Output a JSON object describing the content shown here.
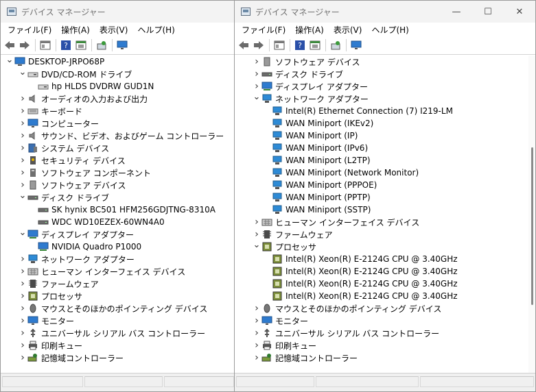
{
  "colors": {
    "accent": "#0067c0",
    "icon_blue": "#2e7bcf",
    "icon_gray": "#707070",
    "icon_green": "#2f7a2f"
  },
  "left": {
    "title": "デバイス マネージャー",
    "menu": [
      "ファイル(F)",
      "操作(A)",
      "表示(V)",
      "ヘルプ(H)"
    ],
    "tree": [
      {
        "depth": 0,
        "exp": "open",
        "icon": "computer-icon",
        "label": "DESKTOP-JRPO68P"
      },
      {
        "depth": 1,
        "exp": "open",
        "icon": "dvd-drive-icon",
        "label": "DVD/CD-ROM ドライブ"
      },
      {
        "depth": 2,
        "exp": "none",
        "icon": "dvd-drive-icon",
        "label": "hp HLDS DVDRW  GUD1N"
      },
      {
        "depth": 1,
        "exp": "closed",
        "icon": "speaker-icon",
        "label": "オーディオの入力および出力"
      },
      {
        "depth": 1,
        "exp": "closed",
        "icon": "keyboard-icon",
        "label": "キーボード"
      },
      {
        "depth": 1,
        "exp": "closed",
        "icon": "monitor-icon",
        "label": "コンピューター"
      },
      {
        "depth": 1,
        "exp": "closed",
        "icon": "speaker-icon",
        "label": "サウンド、ビデオ、およびゲーム コントローラー"
      },
      {
        "depth": 1,
        "exp": "closed",
        "icon": "system-device-icon",
        "label": "システム デバイス"
      },
      {
        "depth": 1,
        "exp": "closed",
        "icon": "security-device-icon",
        "label": "セキュリティ デバイス"
      },
      {
        "depth": 1,
        "exp": "closed",
        "icon": "software-component-icon",
        "label": "ソフトウェア コンポーネント"
      },
      {
        "depth": 1,
        "exp": "closed",
        "icon": "software-device-icon",
        "label": "ソフトウェア デバイス"
      },
      {
        "depth": 1,
        "exp": "open",
        "icon": "disk-drive-icon",
        "label": "ディスク ドライブ"
      },
      {
        "depth": 2,
        "exp": "none",
        "icon": "disk-drive-icon",
        "label": "SK hynix BC501 HFM256GDJTNG-8310A"
      },
      {
        "depth": 2,
        "exp": "none",
        "icon": "disk-drive-icon",
        "label": "WDC WD10EZEX-60WN4A0"
      },
      {
        "depth": 1,
        "exp": "open",
        "icon": "display-adapter-icon",
        "label": "ディスプレイ アダプター"
      },
      {
        "depth": 2,
        "exp": "none",
        "icon": "display-adapter-icon",
        "label": "NVIDIA Quadro P1000"
      },
      {
        "depth": 1,
        "exp": "closed",
        "icon": "network-adapter-icon",
        "label": "ネットワーク アダプター"
      },
      {
        "depth": 1,
        "exp": "closed",
        "icon": "hid-icon",
        "label": "ヒューマン インターフェイス デバイス"
      },
      {
        "depth": 1,
        "exp": "closed",
        "icon": "firmware-icon",
        "label": "ファームウェア"
      },
      {
        "depth": 1,
        "exp": "closed",
        "icon": "processor-icon",
        "label": "プロセッサ"
      },
      {
        "depth": 1,
        "exp": "closed",
        "icon": "mouse-icon",
        "label": "マウスとそのほかのポインティング デバイス"
      },
      {
        "depth": 1,
        "exp": "closed",
        "icon": "monitor-icon",
        "label": "モニター"
      },
      {
        "depth": 1,
        "exp": "closed",
        "icon": "usb-icon",
        "label": "ユニバーサル シリアル バス コントローラー"
      },
      {
        "depth": 1,
        "exp": "closed",
        "icon": "printer-icon",
        "label": "印刷キュー"
      },
      {
        "depth": 1,
        "exp": "closed",
        "icon": "storage-controller-icon",
        "label": "記憶域コントローラー"
      }
    ]
  },
  "right": {
    "title": "デバイス マネージャー",
    "menu": [
      "ファイル(F)",
      "操作(A)",
      "表示(V)",
      "ヘルプ(H)"
    ],
    "caption": {
      "minimize": "—",
      "maximize": "☐",
      "close": "✕"
    },
    "tree": [
      {
        "depth": 1,
        "exp": "closed",
        "icon": "software-device-icon",
        "label": "ソフトウェア デバイス"
      },
      {
        "depth": 1,
        "exp": "closed",
        "icon": "disk-drive-icon",
        "label": "ディスク ドライブ"
      },
      {
        "depth": 1,
        "exp": "closed",
        "icon": "display-adapter-icon",
        "label": "ディスプレイ アダプター"
      },
      {
        "depth": 1,
        "exp": "open",
        "icon": "network-adapter-icon",
        "label": "ネットワーク アダプター"
      },
      {
        "depth": 2,
        "exp": "none",
        "icon": "network-adapter-icon",
        "label": "Intel(R) Ethernet Connection (7) I219-LM"
      },
      {
        "depth": 2,
        "exp": "none",
        "icon": "network-adapter-icon",
        "label": "WAN Miniport (IKEv2)"
      },
      {
        "depth": 2,
        "exp": "none",
        "icon": "network-adapter-icon",
        "label": "WAN Miniport (IP)"
      },
      {
        "depth": 2,
        "exp": "none",
        "icon": "network-adapter-icon",
        "label": "WAN Miniport (IPv6)"
      },
      {
        "depth": 2,
        "exp": "none",
        "icon": "network-adapter-icon",
        "label": "WAN Miniport (L2TP)"
      },
      {
        "depth": 2,
        "exp": "none",
        "icon": "network-adapter-icon",
        "label": "WAN Miniport (Network Monitor)"
      },
      {
        "depth": 2,
        "exp": "none",
        "icon": "network-adapter-icon",
        "label": "WAN Miniport (PPPOE)"
      },
      {
        "depth": 2,
        "exp": "none",
        "icon": "network-adapter-icon",
        "label": "WAN Miniport (PPTP)"
      },
      {
        "depth": 2,
        "exp": "none",
        "icon": "network-adapter-icon",
        "label": "WAN Miniport (SSTP)"
      },
      {
        "depth": 1,
        "exp": "closed",
        "icon": "hid-icon",
        "label": "ヒューマン インターフェイス デバイス"
      },
      {
        "depth": 1,
        "exp": "closed",
        "icon": "firmware-icon",
        "label": "ファームウェア"
      },
      {
        "depth": 1,
        "exp": "open",
        "icon": "processor-icon",
        "label": "プロセッサ"
      },
      {
        "depth": 2,
        "exp": "none",
        "icon": "processor-icon",
        "label": "Intel(R) Xeon(R) E-2124G CPU @ 3.40GHz"
      },
      {
        "depth": 2,
        "exp": "none",
        "icon": "processor-icon",
        "label": "Intel(R) Xeon(R) E-2124G CPU @ 3.40GHz"
      },
      {
        "depth": 2,
        "exp": "none",
        "icon": "processor-icon",
        "label": "Intel(R) Xeon(R) E-2124G CPU @ 3.40GHz"
      },
      {
        "depth": 2,
        "exp": "none",
        "icon": "processor-icon",
        "label": "Intel(R) Xeon(R) E-2124G CPU @ 3.40GHz"
      },
      {
        "depth": 1,
        "exp": "closed",
        "icon": "mouse-icon",
        "label": "マウスとそのほかのポインティング デバイス"
      },
      {
        "depth": 1,
        "exp": "closed",
        "icon": "monitor-icon",
        "label": "モニター"
      },
      {
        "depth": 1,
        "exp": "closed",
        "icon": "usb-icon",
        "label": "ユニバーサル シリアル バス コントローラー"
      },
      {
        "depth": 1,
        "exp": "closed",
        "icon": "printer-icon",
        "label": "印刷キュー"
      },
      {
        "depth": 1,
        "exp": "closed",
        "icon": "storage-controller-icon",
        "label": "記憶域コントローラー"
      }
    ]
  },
  "toolbar_icons": [
    "back-icon",
    "forward-icon",
    "properties-icon",
    "help-icon",
    "action-pane-icon",
    "scan-hardware-icon",
    "display-icon"
  ]
}
